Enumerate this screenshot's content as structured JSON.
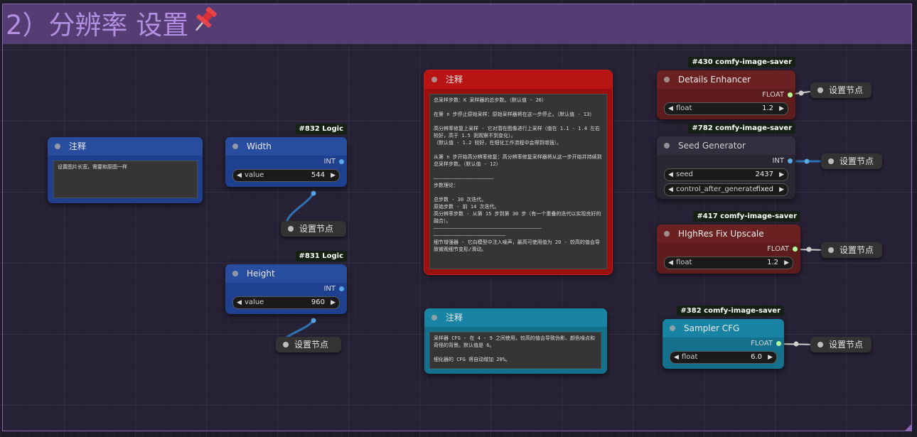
{
  "group": {
    "title": "2）分辨率 设置",
    "pin_icon": "pushpin-icon",
    "color": "#553d74"
  },
  "colors": {
    "blue_node": "#1f3f8f",
    "red_node": "#9b0f0f",
    "teal_node": "#14708c",
    "dark_red_node": "#5e1c1c",
    "dark_node": "#2a2632",
    "wire_blue": "#3d8fd6",
    "wire_white": "#d0d0d0",
    "int_dot": "#5aa9e6",
    "float_dot": "#b2ff9a"
  },
  "notes": {
    "left": {
      "title": "注释",
      "text": "设置图片长宽，需要和原图一样"
    },
    "main": {
      "title": "注释",
      "text": "总采样步数：K 采样器的总步数。（默认值 - 26）\n\n在第 n 步停止原始采样：原始采样器将在这一步停止。（默认值 - 13）\n\n高分辨率修复上采样 - 它对潜在图像进行上采样（值在 1.1 - 1.4 左右较好，高于 1.5 则观察不到变化）。\n（默认值 - 1.2 较好，在细化工作流程中会得到增强）。\n\n从第 n 步开始高分辨率修复：高分辨率修复采样器将从这一步开始并持续到总采样步数。（默认值 - 12）\n\n————————————————————\n步数理论：\n\n总步数 - 30 次迭代。\n原始步数 - 前 14 次迭代。\n高分辨率步数 - 从第 15 步到第 30 步（有一个重叠的迭代以实现良好的融合）。\n————————————————————————————————————\n————————————————————————\n细节增强器 - 它向模型中注入噪声，最高可使用值为 20 - 较高的值会导致微观细节变形/滑动。"
    },
    "cfg": {
      "title": "注释",
      "text": "采样器 CFG - 在 4 - 9 之间使用，较高的值会导致伪影、颜色噪点和奇怪的背景。默认值是 6。\n\n细化器的 CFG 将自动增加 20%。"
    }
  },
  "nodes": {
    "width": {
      "badge": "#832 Logic",
      "title": "Width",
      "output_type": "INT",
      "widget_label": "value",
      "widget_value": "544"
    },
    "height": {
      "badge": "#831 Logic",
      "title": "Height",
      "output_type": "INT",
      "widget_label": "value",
      "widget_value": "960"
    },
    "details": {
      "badge": "#430 comfy-image-saver",
      "title": "Details Enhancer",
      "output_type": "FLOAT",
      "widget_label": "float",
      "widget_value": "1.2"
    },
    "seed": {
      "badge": "#782 comfy-image-saver",
      "title": "Seed Generator",
      "output_type": "INT",
      "widget1_label": "seed",
      "widget1_value": "2437",
      "widget2_label": "control_after_generate",
      "widget2_value": "fixed"
    },
    "hires": {
      "badge": "#417 comfy-image-saver",
      "title": "HIghRes Fix Upscale",
      "output_type": "FLOAT",
      "widget_label": "float",
      "widget_value": "1.2"
    },
    "cfg": {
      "badge": "#382 comfy-image-saver",
      "title": "Sampler CFG",
      "output_type": "FLOAT",
      "widget_label": "float",
      "widget_value": "6.0"
    }
  },
  "reroutes": {
    "label": "设置节点",
    "r1": "设置节点",
    "r2": "设置节点",
    "r3": "设置节点",
    "r4": "设置节点",
    "r5": "设置节点",
    "r6": "设置节点"
  },
  "widget_arrows": {
    "left": "◀",
    "right": "▶"
  }
}
